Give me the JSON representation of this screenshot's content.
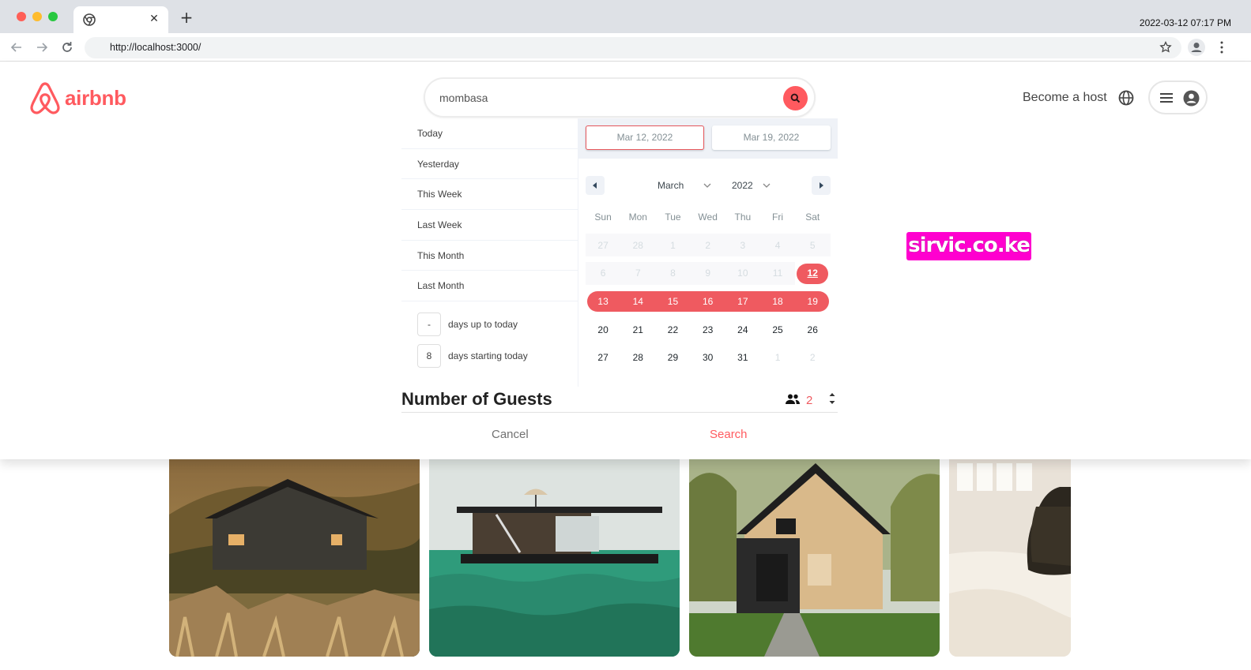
{
  "browser": {
    "tab_title": "",
    "url": "http://localhost:3000/",
    "clock": "2022-03-12 07:17 PM"
  },
  "header": {
    "logo_text": "airbnb",
    "search_value": "mombasa",
    "host_link": "Become a host",
    "brand_color": "#ff5a5f"
  },
  "date_picker": {
    "ranges": [
      "Today",
      "Yesterday",
      "This Week",
      "Last Week",
      "This Month",
      "Last Month"
    ],
    "input_ranges": [
      {
        "value": "-",
        "label": "days up to today"
      },
      {
        "value": "8",
        "label": "days starting today"
      }
    ],
    "start_date": "Mar 12, 2022",
    "end_date": "Mar 19, 2022",
    "month": "March",
    "year": "2022",
    "weekdays": [
      "Sun",
      "Mon",
      "Tue",
      "Wed",
      "Thu",
      "Fri",
      "Sat"
    ],
    "weeks": [
      [
        "27",
        "28",
        "1",
        "2",
        "3",
        "4",
        "5"
      ],
      [
        "6",
        "7",
        "8",
        "9",
        "10",
        "11",
        "12"
      ],
      [
        "13",
        "14",
        "15",
        "16",
        "17",
        "18",
        "19"
      ],
      [
        "20",
        "21",
        "22",
        "23",
        "24",
        "25",
        "26"
      ],
      [
        "27",
        "28",
        "29",
        "30",
        "31",
        "1",
        "2"
      ]
    ],
    "range_color": "#ef5a60"
  },
  "guests": {
    "title": "Number of Guests",
    "value": "2"
  },
  "actions": {
    "cancel": "Cancel",
    "search": "Search"
  },
  "watermark": "sirvic.co.ke",
  "gallery": [
    "cabin-on-hill",
    "houseboat-on-sea",
    "a-frame-house",
    "bedroom-with-dog"
  ]
}
